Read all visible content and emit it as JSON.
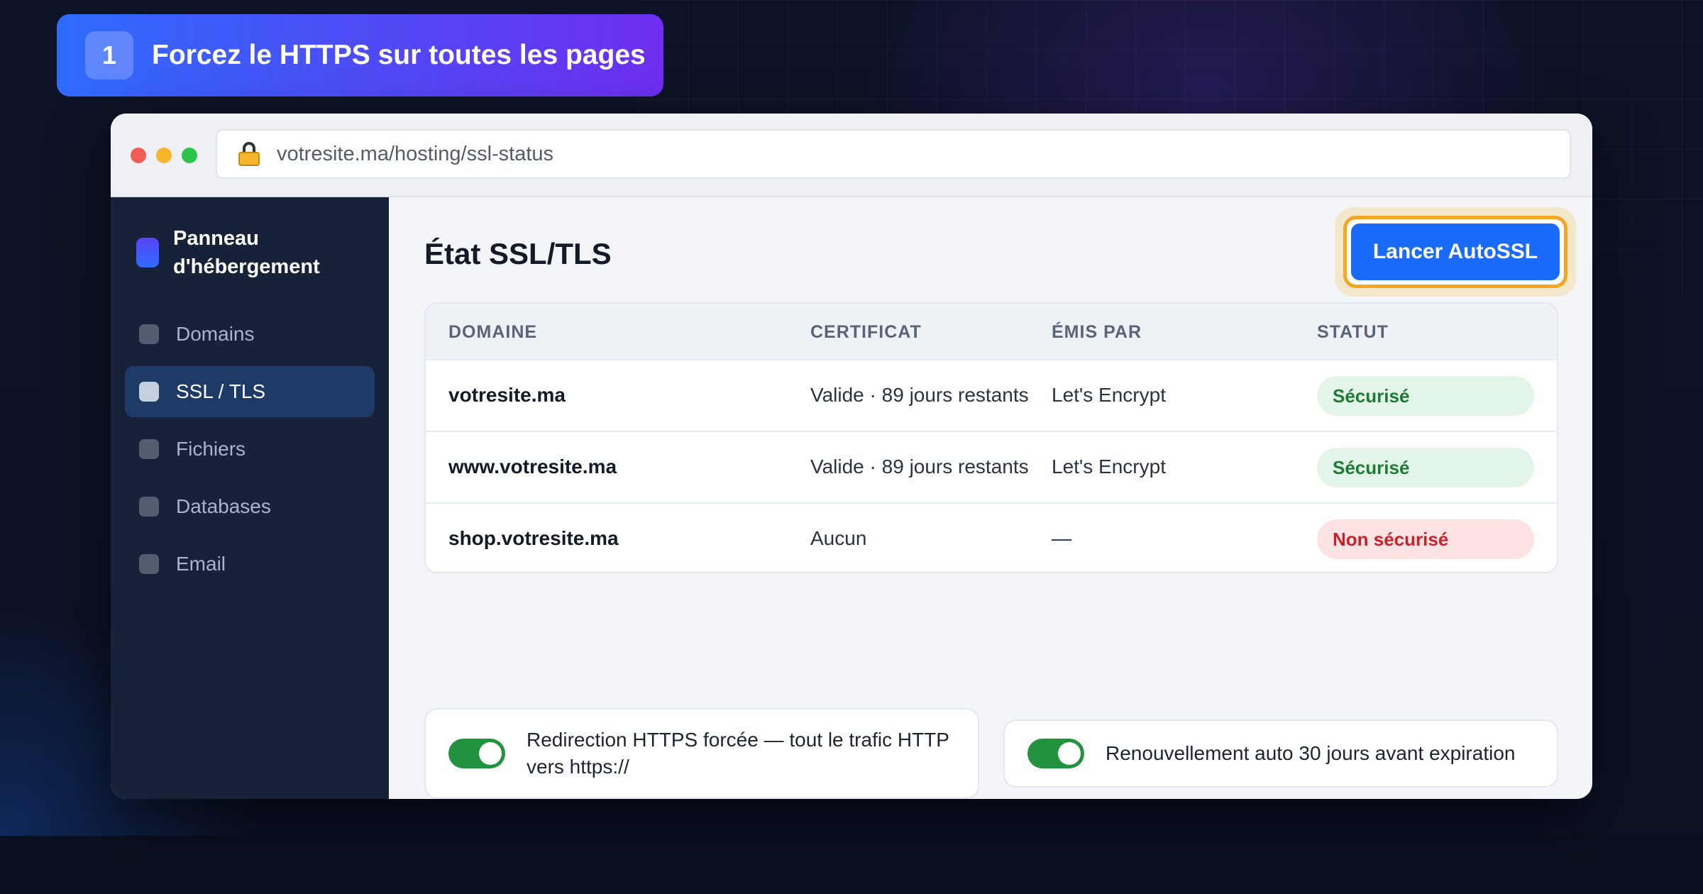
{
  "step": {
    "number": "1",
    "title": "Forcez le HTTPS sur toutes les pages"
  },
  "browser": {
    "url": "votresite.ma/hosting/ssl-status"
  },
  "sidebar": {
    "brand": "Panneau d'hébergement",
    "items": [
      {
        "label": "Domains",
        "active": false
      },
      {
        "label": "SSL / TLS",
        "active": true
      },
      {
        "label": "Fichiers",
        "active": false
      },
      {
        "label": "Databases",
        "active": false
      },
      {
        "label": "Email",
        "active": false
      }
    ]
  },
  "main": {
    "title": "État SSL/TLS",
    "autossl_button": "Lancer AutoSSL",
    "table": {
      "headers": [
        "DOMAINE",
        "CERTIFICAT",
        "ÉMIS PAR",
        "STATUT"
      ],
      "rows": [
        {
          "domain": "votresite.ma",
          "certificate": "Valide · 89 jours restants",
          "issuer": "Let's Encrypt",
          "status": "Sécurisé",
          "status_type": "ok"
        },
        {
          "domain": "www.votresite.ma",
          "certificate": "Valide · 89 jours restants",
          "issuer": "Let's Encrypt",
          "status": "Sécurisé",
          "status_type": "ok"
        },
        {
          "domain": "shop.votresite.ma",
          "certificate": "Aucun",
          "issuer": "—",
          "status": "Non sécurisé",
          "status_type": "bad"
        }
      ]
    },
    "toggles": [
      {
        "label": "Redirection HTTPS forcée — tout le trafic HTTP vers https://",
        "on": true
      },
      {
        "label": "Renouvellement auto 30 jours avant expiration",
        "on": true
      }
    ]
  },
  "colors": {
    "accent": "#1a6bfa",
    "highlight": "#f5a623",
    "ok": "#1f7a35",
    "bad": "#c8232b",
    "toggle_on": "#22923e"
  }
}
